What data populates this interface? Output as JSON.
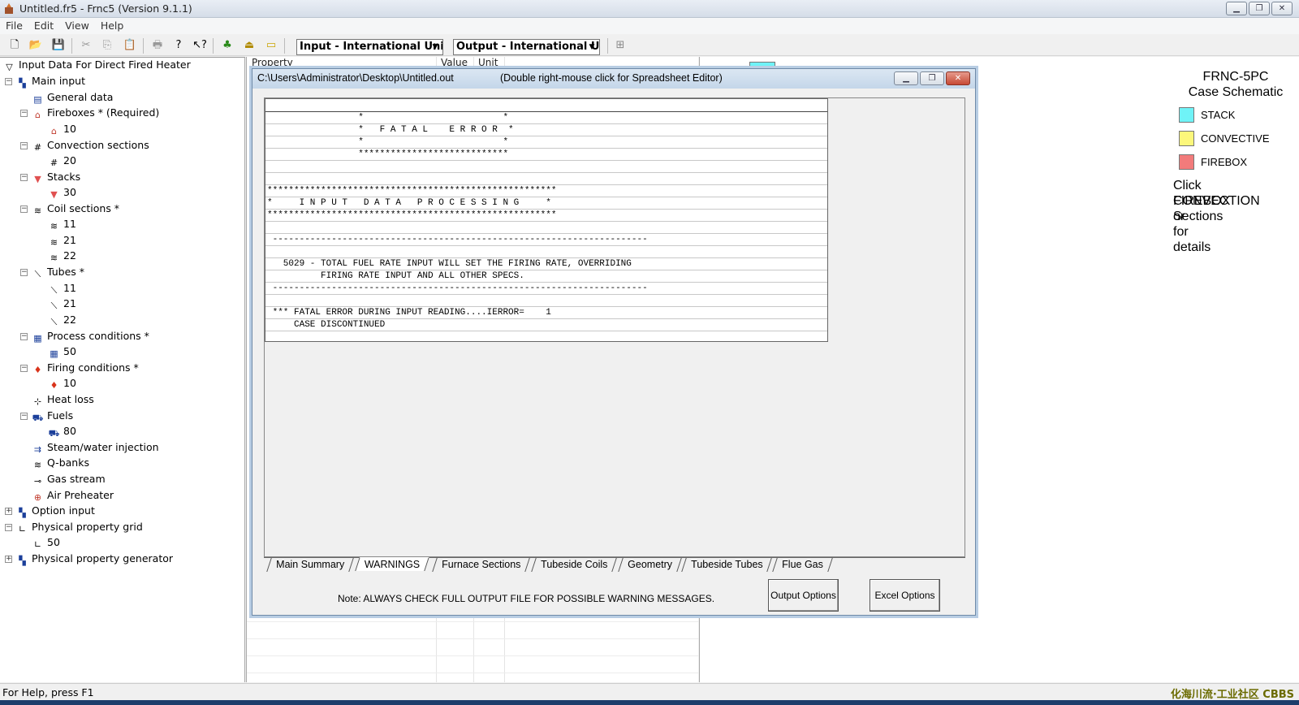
{
  "window": {
    "title": "Untitled.fr5 - Frnc5 (Version 9.1.1)",
    "controls": [
      "minimize",
      "maximize",
      "close"
    ]
  },
  "menu": [
    {
      "label": "File"
    },
    {
      "label": "Edit"
    },
    {
      "label": "View"
    },
    {
      "label": "Help"
    }
  ],
  "toolbar": {
    "input_units": "Input - International Units",
    "output_units": "Output - International Uni",
    "icons": [
      "new-file-icon",
      "open-folder-icon",
      "save-icon",
      "cut-icon",
      "copy-icon",
      "paste-icon",
      "print-icon",
      "help-icon",
      "context-help-icon",
      "tree-icon",
      "run-icon",
      "folder-icon",
      "tree-view-icon"
    ]
  },
  "tree": {
    "root": "Input Data For Direct Fired Heater",
    "items": [
      {
        "label": "Main input",
        "icon": "main-input-icon"
      },
      {
        "label": "General data",
        "icon": "general-data-icon"
      },
      {
        "label": "Fireboxes * (Required)",
        "icon": "firebox-icon"
      },
      {
        "label": "10",
        "icon": "firebox-icon"
      },
      {
        "label": "Convection sections",
        "icon": "convection-icon"
      },
      {
        "label": "20",
        "icon": "convection-icon"
      },
      {
        "label": "Stacks",
        "icon": "stack-icon"
      },
      {
        "label": "30",
        "icon": "stack-icon"
      },
      {
        "label": "Coil sections *",
        "icon": "coil-icon"
      },
      {
        "label": "11",
        "icon": "coil-icon"
      },
      {
        "label": "21",
        "icon": "coil-icon"
      },
      {
        "label": "22",
        "icon": "coil-icon"
      },
      {
        "label": "Tubes *",
        "icon": "tube-icon"
      },
      {
        "label": "11",
        "icon": "tube-icon"
      },
      {
        "label": "21",
        "icon": "tube-icon"
      },
      {
        "label": "22",
        "icon": "tube-icon"
      },
      {
        "label": "Process conditions *",
        "icon": "process-conditions-icon"
      },
      {
        "label": "50",
        "icon": "process-conditions-icon"
      },
      {
        "label": "Firing conditions *",
        "icon": "flame-icon"
      },
      {
        "label": "10",
        "icon": "flame-icon"
      },
      {
        "label": "Heat loss",
        "icon": "heat-loss-icon"
      },
      {
        "label": "Fuels",
        "icon": "fuel-icon"
      },
      {
        "label": "80",
        "icon": "fuel-icon"
      },
      {
        "label": "Steam/water injection",
        "icon": "steam-icon"
      },
      {
        "label": "Q-banks",
        "icon": "coil-icon"
      },
      {
        "label": "Gas stream",
        "icon": "gas-stream-icon"
      },
      {
        "label": "Air Preheater",
        "icon": "air-preheater-icon"
      },
      {
        "label": "Option input",
        "icon": "main-input-icon"
      },
      {
        "label": "Physical property grid",
        "icon": "graph-icon"
      },
      {
        "label": "50",
        "icon": "graph-icon"
      },
      {
        "label": "Physical property generator",
        "icon": "main-input-icon"
      }
    ]
  },
  "sheet": {
    "headers": [
      "Property",
      "Value",
      "Unit"
    ]
  },
  "schematic": {
    "title_line1": "FRNC-5PC",
    "title_line2": "Case Schematic",
    "legend": [
      {
        "label": "STACK",
        "color": "#6ff3f7"
      },
      {
        "label": "CONVECTIVE",
        "color": "#fcf77b"
      },
      {
        "label": "FIREBOX",
        "color": "#f27b7b"
      }
    ],
    "click_note": [
      "Click FIREBOX or",
      "CONVECTION",
      "Sections for details"
    ]
  },
  "dialog": {
    "path": "C:\\Users\\Administrator\\Desktop\\Untitled.out",
    "hint": "(Double right-mouse click for Spreadsheet Editor)",
    "lines": [
      "",
      "                 *                          *",
      "                 *   F A T A L    E R R O R  *",
      "                 *                          *",
      "                 ****************************",
      "",
      "",
      "******************************************************",
      "*     I N P U T   D A T A   P R O C E S S I N G     *",
      "******************************************************",
      "",
      " ----------------------------------------------------------------------",
      "",
      "   5029 - TOTAL FUEL RATE INPUT WILL SET THE FIRING RATE, OVERRIDING",
      "          FIRING RATE INPUT AND ALL OTHER SPECS.",
      " ----------------------------------------------------------------------",
      "",
      " *** FATAL ERROR DURING INPUT READING....IERROR=    1",
      "     CASE DISCONTINUED",
      ""
    ],
    "tabs": [
      "Main Summary",
      "WARNINGS",
      "Furnace Sections",
      "Tubeside Coils",
      "Geometry",
      "Tubeside Tubes",
      "Flue Gas"
    ],
    "active_tab": "WARNINGS",
    "note": "Note:  ALWAYS CHECK FULL OUTPUT FILE FOR POSSIBLE WARNING MESSAGES.",
    "buttons": {
      "output_options": "Output Options",
      "excel_options": "Excel Options"
    }
  },
  "status": {
    "text": "For Help, press F1",
    "watermark": "化海川流·工业社区 CBBS"
  }
}
